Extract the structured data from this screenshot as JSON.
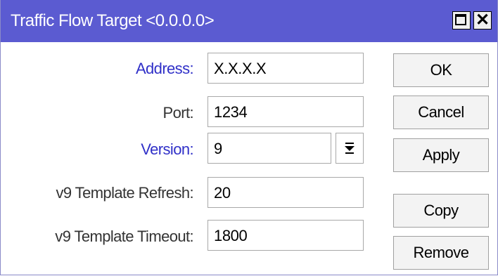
{
  "window": {
    "title": "Traffic Flow Target <0.0.0.0>",
    "close_glyph": "✕",
    "icons": [
      "maximize-icon",
      "close-icon"
    ]
  },
  "form": {
    "address": {
      "label": "Address:",
      "value": "X.X.X.X"
    },
    "port": {
      "label": "Port:",
      "value": "1234"
    },
    "version": {
      "label": "Version:",
      "value": "9"
    },
    "refresh": {
      "label": "v9 Template Refresh:",
      "value": "20"
    },
    "timeout": {
      "label": "v9 Template Timeout:",
      "value": "1800"
    }
  },
  "buttons": {
    "ok": "OK",
    "cancel": "Cancel",
    "apply": "Apply",
    "copy": "Copy",
    "remove": "Remove"
  },
  "colors": {
    "titlebar": "#5b5bd1",
    "label_highlight": "#3030c8"
  }
}
